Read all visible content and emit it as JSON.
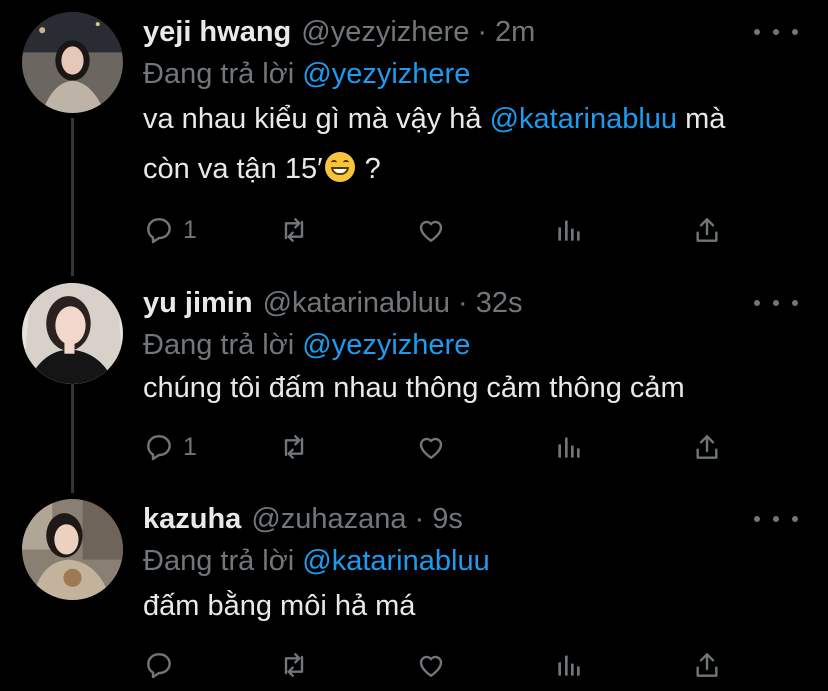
{
  "tweets": [
    {
      "name": "yeji hwang",
      "handle": "@yezyizhere",
      "separator": "·",
      "time": "2m",
      "reply_prefix": "Đang trả lời",
      "reply_to": "@yezyizhere",
      "text_line1_pre": "va nhau kiểu gì mà vậy hả ",
      "text_line1_mention": "@katarinabluu",
      "text_line1_post": " mà",
      "text_line2_pre": "còn va tận 15′",
      "text_line2_post": " ?",
      "reply_count": "1"
    },
    {
      "name": "yu jimin",
      "handle": "@katarinabluu",
      "separator": "·",
      "time": "32s",
      "reply_prefix": "Đang trả lời",
      "reply_to": "@yezyizhere",
      "text": "chúng tôi đấm nhau thông cảm thông cảm",
      "reply_count": "1"
    },
    {
      "name": "kazuha",
      "handle": "@zuhazana",
      "separator": "·",
      "time": "9s",
      "reply_prefix": "Đang trả lời",
      "reply_to": "@katarinabluu",
      "text": "đấm bằng môi hả má",
      "reply_count": ""
    }
  ],
  "icons": {
    "reply": "reply-icon",
    "retweet": "retweet-icon",
    "like": "heart-icon",
    "analytics": "analytics-icon",
    "share": "share-icon",
    "more": "more-icon",
    "emoji": "grinning-face-emoji"
  },
  "colors": {
    "background": "#000000",
    "text": "#e7e9ea",
    "secondary": "#71767b",
    "accent": "#1d9bf0"
  }
}
